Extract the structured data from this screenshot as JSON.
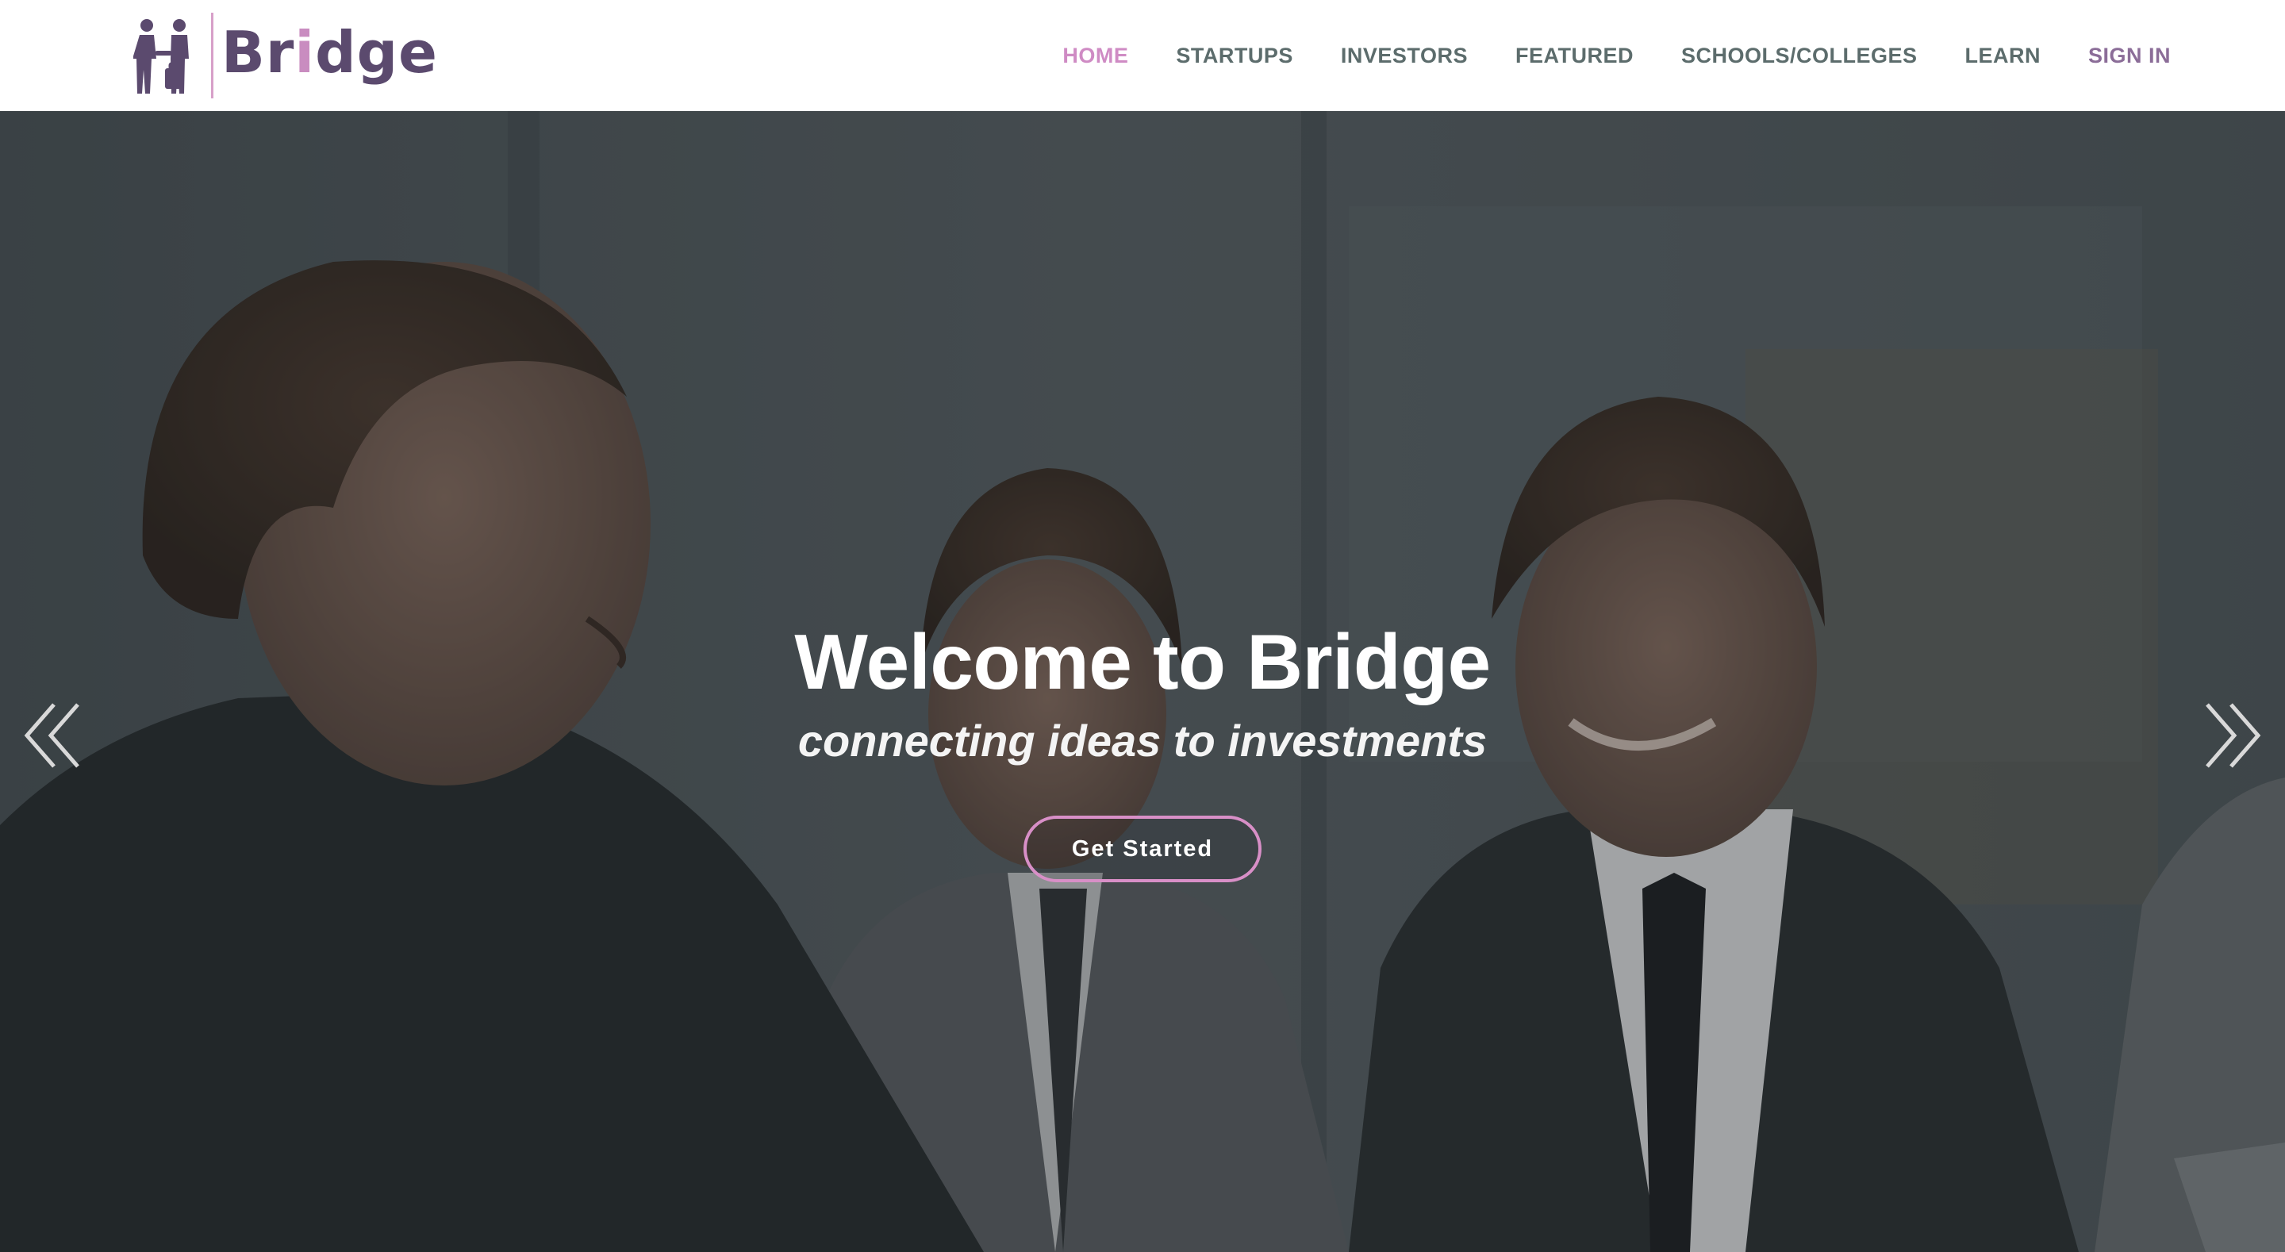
{
  "brand": {
    "name_prefix": "Br",
    "name_highlight": "i",
    "name_suffix": "dge",
    "colors": {
      "primary": "#5b4a6e",
      "accent": "#cf8bc4",
      "nav_text": "#5c6c6c"
    },
    "logo_icon": "two-people-handshake-luggage-icon"
  },
  "nav": {
    "items": [
      {
        "label": "HOME",
        "active": true
      },
      {
        "label": "STARTUPS",
        "active": false
      },
      {
        "label": "INVESTORS",
        "active": false
      },
      {
        "label": "FEATURED",
        "active": false
      },
      {
        "label": "SCHOOLS/COLLEGES",
        "active": false
      },
      {
        "label": "LEARN",
        "active": false
      },
      {
        "label": "SIGN IN",
        "active": false
      }
    ]
  },
  "hero": {
    "title": "Welcome to Bridge",
    "subtitle": "connecting ideas to investments",
    "cta_label": "Get Started",
    "prev_icon": "double-chevron-left-icon",
    "next_icon": "double-chevron-right-icon"
  }
}
